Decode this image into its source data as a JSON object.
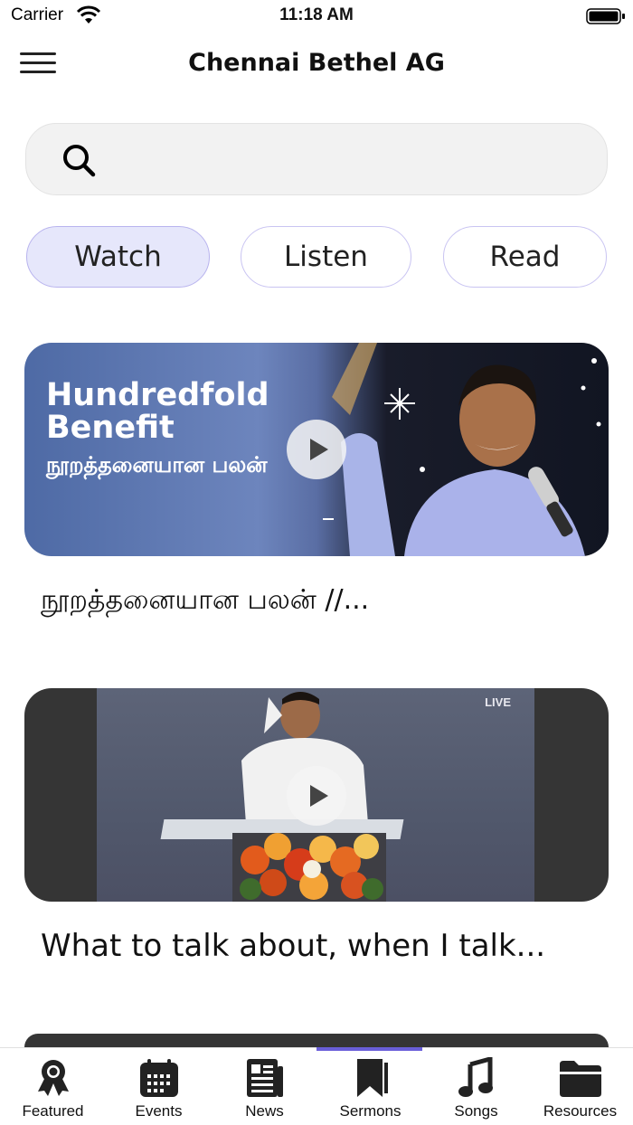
{
  "status_bar": {
    "carrier": "Carrier",
    "time": "11:18 AM"
  },
  "nav": {
    "title": "Chennai Bethel AG"
  },
  "search": {
    "placeholder": "",
    "value": ""
  },
  "segments": [
    {
      "label": "Watch",
      "active": true
    },
    {
      "label": "Listen",
      "active": false
    },
    {
      "label": "Read",
      "active": false
    }
  ],
  "sermons": [
    {
      "thumbnail_headline": "Hundredfold Benefit",
      "thumbnail_tamil": "நூறத்தனையான பலன்",
      "title": "நூறத்தனையான பலன் //..."
    },
    {
      "thumbnail_badge": "LIVE",
      "title": "What to talk about, when I talk..."
    }
  ],
  "tabs": [
    {
      "label": "Featured",
      "icon": "award-icon"
    },
    {
      "label": "Events",
      "icon": "calendar-icon"
    },
    {
      "label": "News",
      "icon": "newspaper-icon"
    },
    {
      "label": "Sermons",
      "icon": "bookmark-icon",
      "active": true
    },
    {
      "label": "Songs",
      "icon": "music-note-icon"
    },
    {
      "label": "Resources",
      "icon": "folder-icon"
    }
  ],
  "colors": {
    "accent": "#6a5fd9",
    "segment_active_bg": "#e6e7fb",
    "segment_border": "#c9c4f2"
  }
}
